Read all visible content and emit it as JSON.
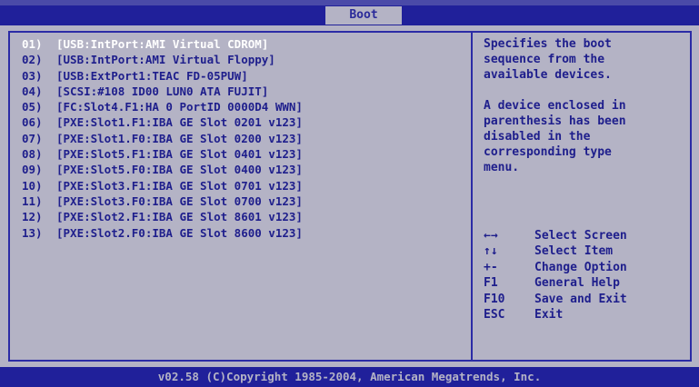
{
  "header": {
    "tab_label": "Boot"
  },
  "boot_list": [
    {
      "num": "01)",
      "device": "[USB:IntPort:AMI Virtual CDROM]",
      "selected": true
    },
    {
      "num": "02)",
      "device": "[USB:IntPort:AMI Virtual Floppy]",
      "selected": false
    },
    {
      "num": "03)",
      "device": "[USB:ExtPort1:TEAC FD-05PUW]",
      "selected": false
    },
    {
      "num": "04)",
      "device": "[SCSI:#108 ID00 LUN0 ATA FUJIT]",
      "selected": false
    },
    {
      "num": "05)",
      "device": "[FC:Slot4.F1:HA 0 PortID 0000D4 WWN]",
      "selected": false
    },
    {
      "num": "06)",
      "device": "[PXE:Slot1.F1:IBA GE Slot 0201 v123]",
      "selected": false
    },
    {
      "num": "07)",
      "device": "[PXE:Slot1.F0:IBA GE Slot 0200 v123]",
      "selected": false
    },
    {
      "num": "08)",
      "device": "[PXE:Slot5.F1:IBA GE Slot 0401 v123]",
      "selected": false
    },
    {
      "num": "09)",
      "device": "[PXE:Slot5.F0:IBA GE Slot 0400 v123]",
      "selected": false
    },
    {
      "num": "10)",
      "device": "[PXE:Slot3.F1:IBA GE Slot 0701 v123]",
      "selected": false
    },
    {
      "num": "11)",
      "device": "[PXE:Slot3.F0:IBA GE Slot 0700 v123]",
      "selected": false
    },
    {
      "num": "12)",
      "device": "[PXE:Slot2.F1:IBA GE Slot 8601 v123]",
      "selected": false
    },
    {
      "num": "13)",
      "device": "[PXE:Slot2.F0:IBA GE Slot 8600 v123]",
      "selected": false
    }
  ],
  "help": {
    "para1": "Specifies the boot\nsequence from the\navailable devices.",
    "para2": "A device enclosed in\nparenthesis has been\ndisabled in the\ncorresponding type\nmenu."
  },
  "keys": [
    {
      "key": "←→",
      "action": "Select Screen"
    },
    {
      "key": "↑↓",
      "action": "Select Item"
    },
    {
      "key": "+-",
      "action": "Change Option"
    },
    {
      "key": "F1",
      "action": "General Help"
    },
    {
      "key": "F10",
      "action": "Save and Exit"
    },
    {
      "key": "ESC",
      "action": "Exit"
    }
  ],
  "footer": {
    "copyright": "v02.58 (C)Copyright 1985-2004, American Megatrends, Inc."
  },
  "colors": {
    "background": "#b4b3c5",
    "bar": "#20209a",
    "text": "#1e1e8c",
    "selected_text": "#ffffff"
  }
}
